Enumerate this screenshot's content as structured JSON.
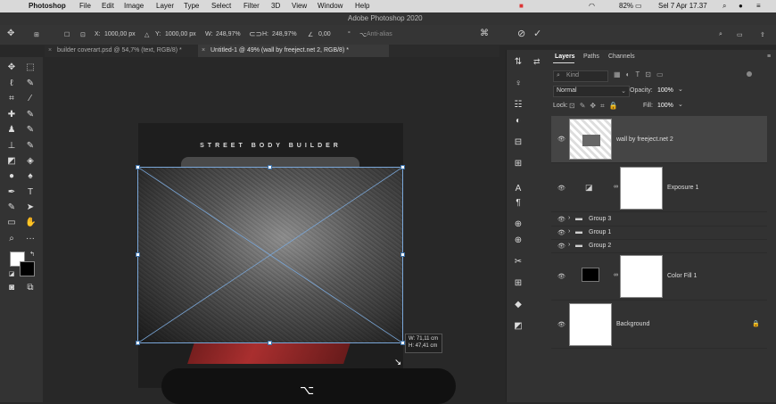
{
  "menubar": {
    "app": "Photoshop",
    "items": [
      "File",
      "Edit",
      "Image",
      "Layer",
      "Type",
      "Select",
      "Filter",
      "3D",
      "View",
      "Window",
      "Help"
    ],
    "battery": "82%",
    "datetime": "Sel 7 Apr  17.37"
  },
  "window_title": "Adobe Photoshop 2020",
  "options": {
    "x_label": "X:",
    "x_value": "1000,00 px",
    "y_label": "Y:",
    "y_value": "1000,00 px",
    "w_label": "W:",
    "w_value": "248,97%",
    "h_label": "H:",
    "h_value": "248,97%",
    "angle_value": "0,00",
    "degree": "°",
    "antialias": "Anti-alias"
  },
  "tabs": [
    {
      "label": "builder coverart.psd @ 54,7% (text, RGB/8) *"
    },
    {
      "label": "Untitled-1 @ 49% (wall by freeject.net 2, RGB/8) *"
    }
  ],
  "canvas": {
    "header_text": "STREET BODY BUILDER",
    "dim_w": "W: 71,11 cm",
    "dim_h": "H: 47,41 cm"
  },
  "layers_panel": {
    "tabs": [
      "Layers",
      "Paths",
      "Channels"
    ],
    "filter_label": "Kind",
    "blend_mode": "Normal",
    "opacity_label": "Opacity:",
    "opacity_value": "100%",
    "lock_label": "Lock:",
    "fill_label": "Fill:",
    "fill_value": "100%",
    "layers": [
      {
        "name": "wall by freeject.net 2"
      },
      {
        "name": "Exposure 1"
      },
      {
        "name": "Group 3"
      },
      {
        "name": "Group 1"
      },
      {
        "name": "Group 2"
      },
      {
        "name": "Color Fill 1"
      },
      {
        "name": "Background"
      }
    ]
  }
}
